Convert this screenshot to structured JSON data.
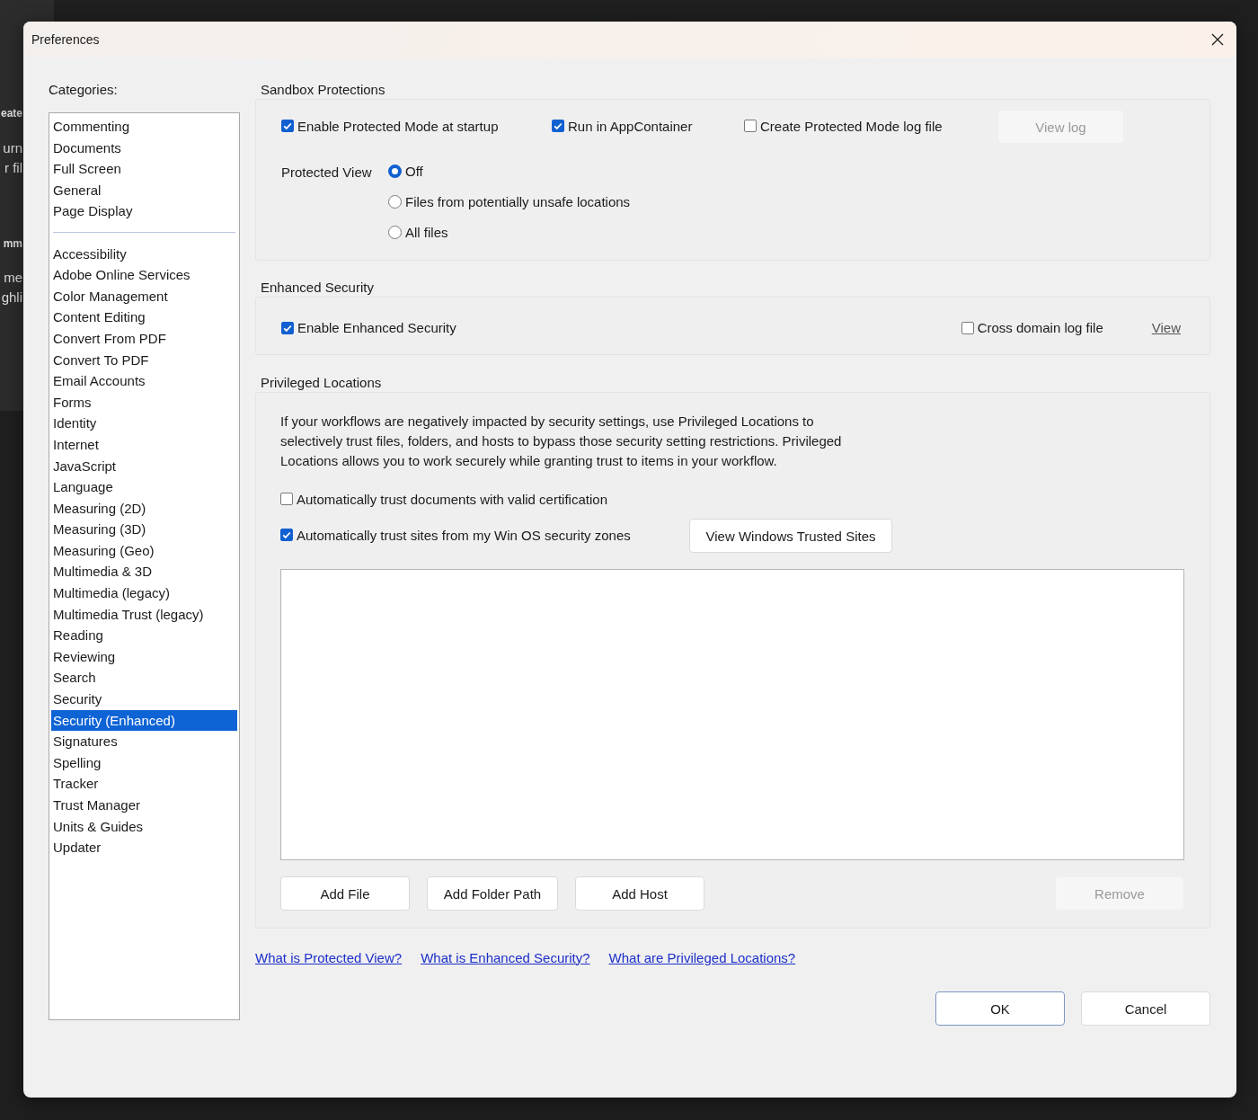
{
  "background_app": {
    "fragments": [
      {
        "text": "eate",
        "kind": "heading"
      },
      {
        "text": "urn",
        "kind": "text"
      },
      {
        "text": "r fil",
        "kind": "text"
      },
      {
        "text": "mm",
        "kind": "heading"
      },
      {
        "text": "me",
        "kind": "text"
      },
      {
        "text": "ghli",
        "kind": "text"
      }
    ]
  },
  "window": {
    "title": "Preferences"
  },
  "categories": {
    "label": "Categories:",
    "groups": [
      [
        {
          "label": "Commenting",
          "selected": false
        },
        {
          "label": "Documents",
          "selected": false
        },
        {
          "label": "Full Screen",
          "selected": false
        },
        {
          "label": "General",
          "selected": false
        },
        {
          "label": "Page Display",
          "selected": false
        }
      ],
      [
        {
          "label": "Accessibility",
          "selected": false
        },
        {
          "label": "Adobe Online Services",
          "selected": false
        },
        {
          "label": "Color Management",
          "selected": false
        },
        {
          "label": "Content Editing",
          "selected": false
        },
        {
          "label": "Convert From PDF",
          "selected": false
        },
        {
          "label": "Convert To PDF",
          "selected": false
        },
        {
          "label": "Email Accounts",
          "selected": false
        },
        {
          "label": "Forms",
          "selected": false
        },
        {
          "label": "Identity",
          "selected": false
        },
        {
          "label": "Internet",
          "selected": false
        },
        {
          "label": "JavaScript",
          "selected": false
        },
        {
          "label": "Language",
          "selected": false
        },
        {
          "label": "Measuring (2D)",
          "selected": false
        },
        {
          "label": "Measuring (3D)",
          "selected": false
        },
        {
          "label": "Measuring (Geo)",
          "selected": false
        },
        {
          "label": "Multimedia & 3D",
          "selected": false
        },
        {
          "label": "Multimedia (legacy)",
          "selected": false
        },
        {
          "label": "Multimedia Trust (legacy)",
          "selected": false
        },
        {
          "label": "Reading",
          "selected": false
        },
        {
          "label": "Reviewing",
          "selected": false
        },
        {
          "label": "Search",
          "selected": false
        },
        {
          "label": "Security",
          "selected": false
        },
        {
          "label": "Security (Enhanced)",
          "selected": true
        },
        {
          "label": "Signatures",
          "selected": false
        },
        {
          "label": "Spelling",
          "selected": false
        },
        {
          "label": "Tracker",
          "selected": false
        },
        {
          "label": "Trust Manager",
          "selected": false
        },
        {
          "label": "Units & Guides",
          "selected": false
        },
        {
          "label": "Updater",
          "selected": false
        }
      ]
    ]
  },
  "sandbox_protections": {
    "title": "Sandbox Protections",
    "checkboxes": [
      {
        "label": "Enable Protected Mode at startup",
        "checked": true
      },
      {
        "label": "Run in AppContainer",
        "checked": true
      },
      {
        "label": "Create Protected Mode log file",
        "checked": false
      }
    ],
    "view_log_button": {
      "label": "View log",
      "disabled": true
    },
    "protected_view": {
      "label": "Protected View",
      "options": [
        {
          "label": "Off",
          "selected": true
        },
        {
          "label": "Files from potentially unsafe locations",
          "selected": false
        },
        {
          "label": "All files",
          "selected": false
        }
      ]
    }
  },
  "enhanced_security": {
    "title": "Enhanced Security",
    "enable": {
      "label": "Enable Enhanced Security",
      "checked": true
    },
    "cross_domain_log": {
      "label": "Cross domain log file",
      "checked": false
    },
    "view_link": "View"
  },
  "privileged_locations": {
    "title": "Privileged Locations",
    "description": "If your workflows are negatively impacted by security settings, use Privileged Locations to selectively trust files, folders, and hosts to bypass those security setting restrictions. Privileged Locations allows you to work securely while granting trust to items in your workflow.",
    "auto_trust_certified": {
      "label": "Automatically trust documents with valid certification",
      "checked": false
    },
    "auto_trust_sites": {
      "label": "Automatically trust sites from my Win OS security zones",
      "checked": true
    },
    "view_trusted_sites_button": "View Windows Trusted Sites",
    "buttons": [
      {
        "label": "Add File",
        "disabled": false
      },
      {
        "label": "Add Folder Path",
        "disabled": false
      },
      {
        "label": "Add Host",
        "disabled": false
      },
      {
        "label": "Remove",
        "disabled": true
      }
    ]
  },
  "help_links": [
    "What is Protected View?",
    "What is Enhanced Security?",
    "What are Privileged Locations?"
  ],
  "dialog_buttons": [
    {
      "label": "OK",
      "default": true
    },
    {
      "label": "Cancel",
      "default": false
    }
  ]
}
